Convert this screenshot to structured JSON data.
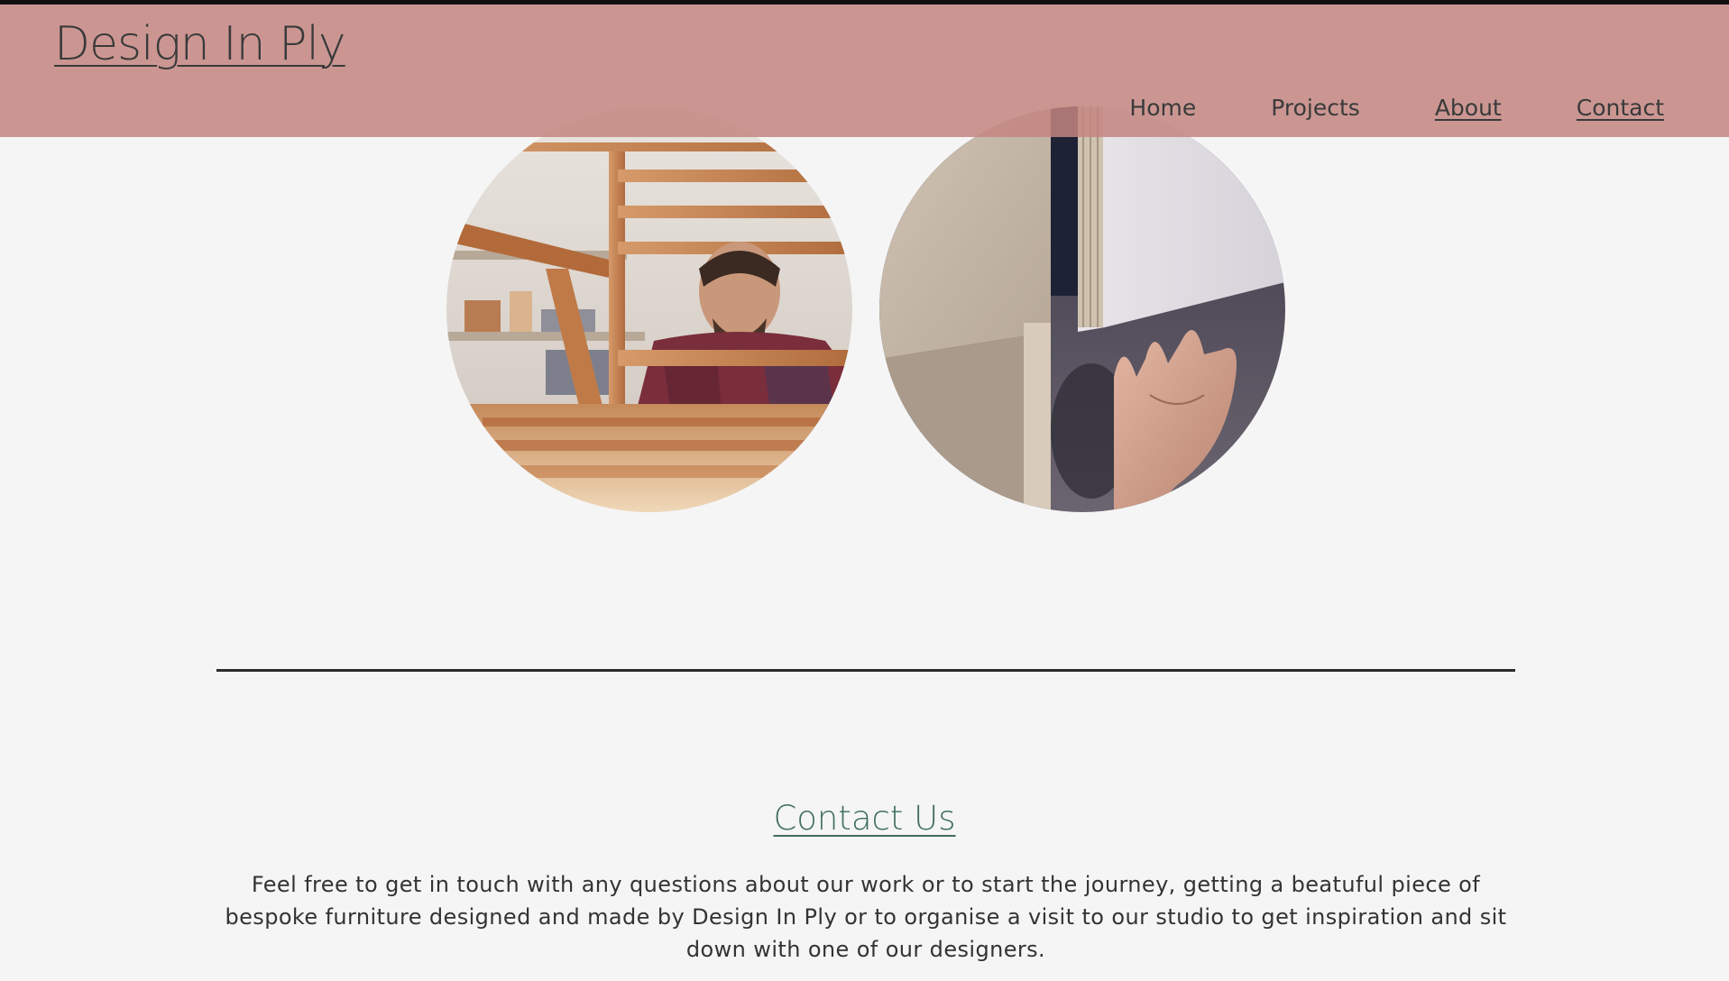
{
  "header": {
    "logo": "Design In Ply",
    "nav": [
      "Home",
      "Projects",
      "About",
      "Contact"
    ],
    "background_color": "#c3857f"
  },
  "images": [
    {
      "name": "woodworker-image",
      "description_icon": "workshop-photo"
    },
    {
      "name": "plywood-hand-image",
      "description_icon": "plywood-photo"
    }
  ],
  "contact": {
    "title": "Contact Us",
    "text": "Feel free to get in touch with any questions about our work or to start the journey, getting a beatuful piece of bespoke furniture designed and made by Design In Ply or to organise a visit to our studio to get inspiration and sit down with one of our designers."
  },
  "colors": {
    "background": "#f5f5f5",
    "accent_green": "#3f6e5a",
    "divider": "#2a2a2a"
  }
}
